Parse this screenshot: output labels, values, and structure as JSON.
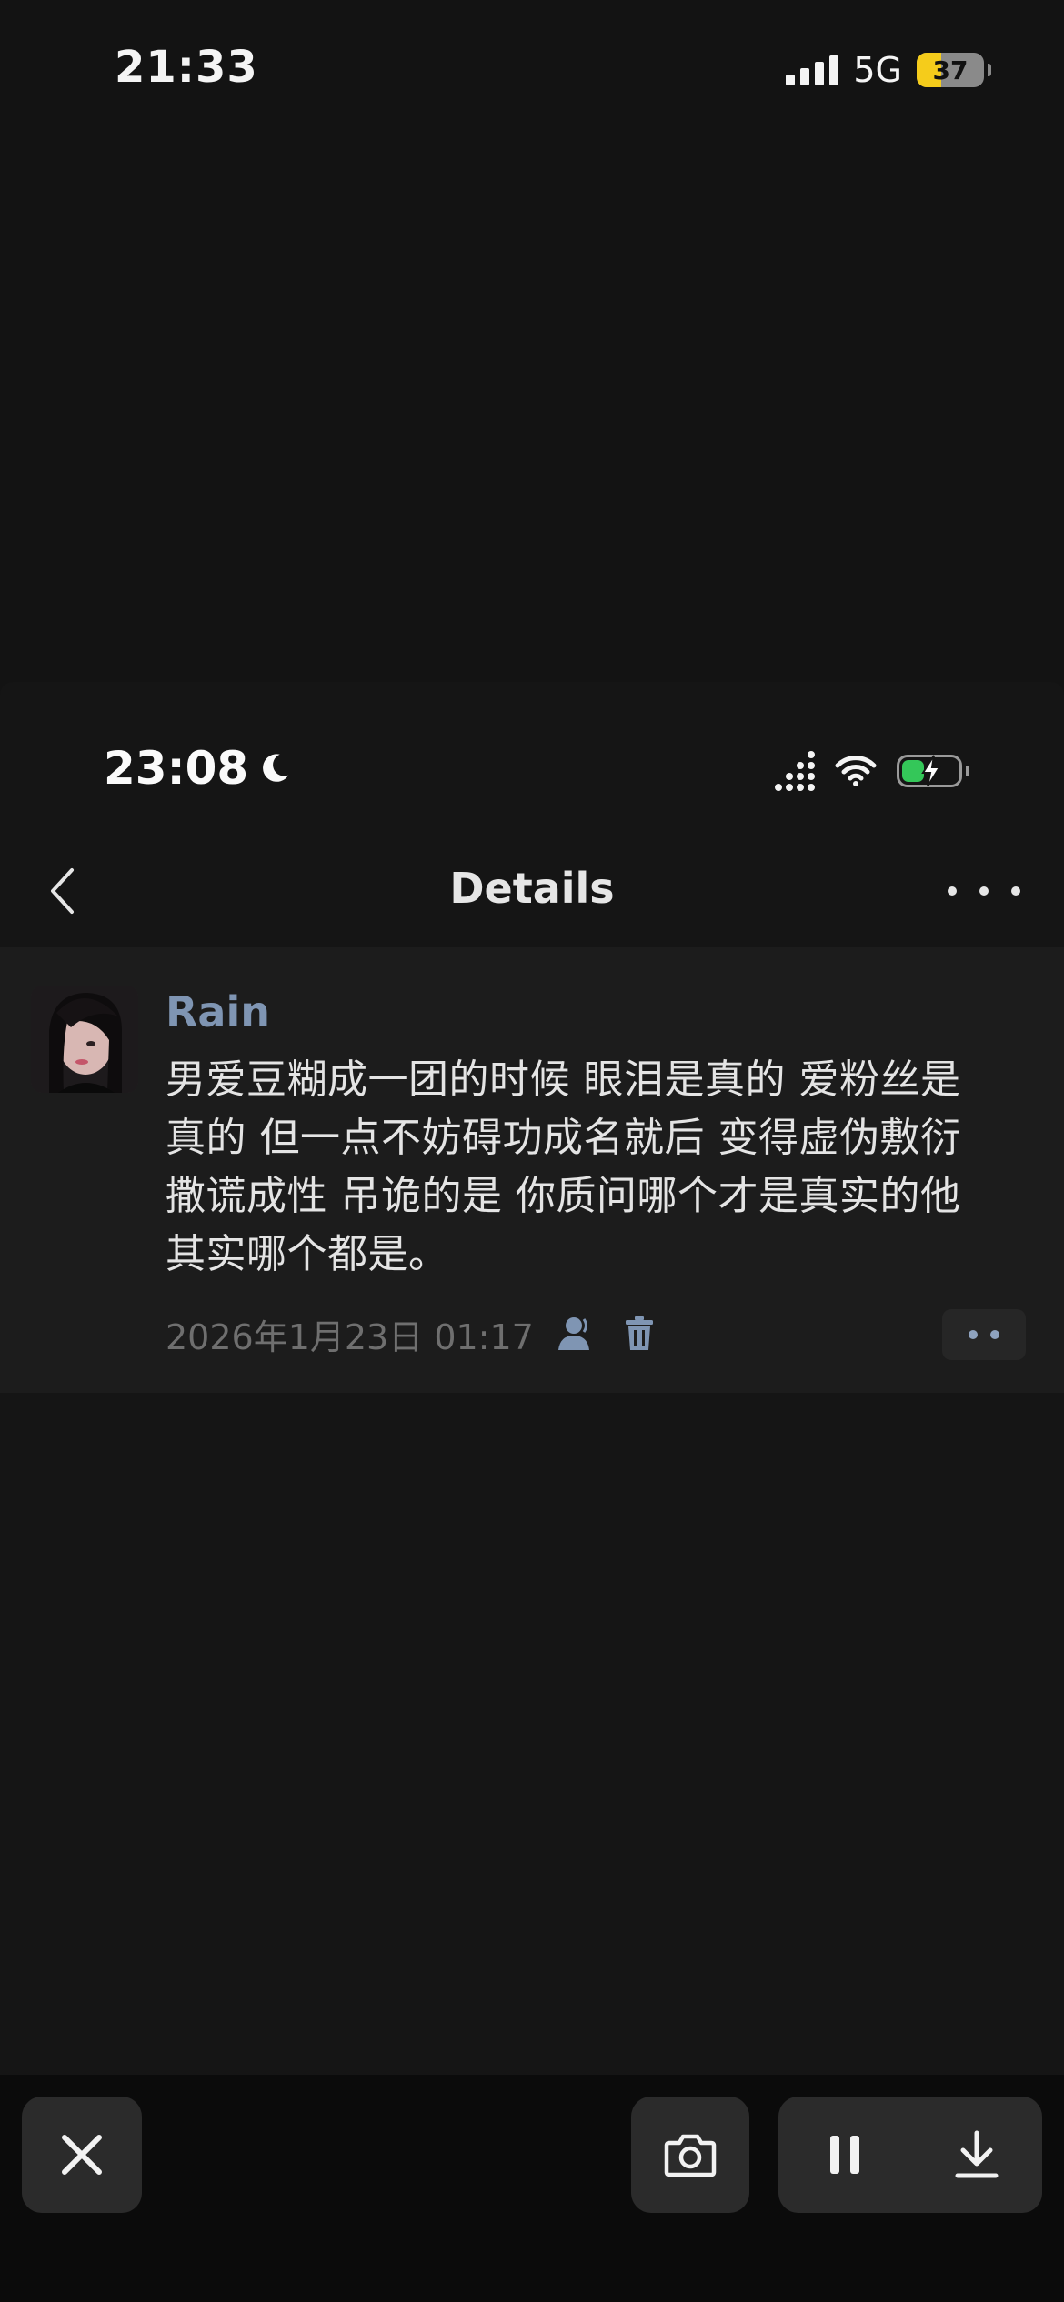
{
  "outer_status": {
    "time": "21:33",
    "network": "5G",
    "battery_percent": "37",
    "battery_level": 0.37,
    "battery_color": "#f5cc1b"
  },
  "inner_status": {
    "time": "23:08",
    "focus_icon": "moon-icon",
    "battery_charging": true,
    "battery_color": "#34c759"
  },
  "nav": {
    "back_icon": "chevron-left-icon",
    "title": "Details",
    "more_icon": "more-horizontal-icon"
  },
  "post": {
    "username": "Rain",
    "username_color": "#7f95b3",
    "content_lines": [
      "男爱豆糊成一团的时候 眼泪是真的 爱粉丝是",
      "真的 但一点不妨碍功成名就后 变得虚伪敷衍",
      "撒谎成性 吊诡的是 你质问哪个才是真实的他",
      "其实哪个都是。"
    ],
    "timestamp": "2026年1月23日 01:17",
    "icons": [
      "person-icon",
      "trash-icon",
      "more-icon"
    ]
  },
  "toolbar": {
    "buttons": [
      "close-icon",
      "camera-icon",
      "pause-icon",
      "download-icon"
    ]
  }
}
